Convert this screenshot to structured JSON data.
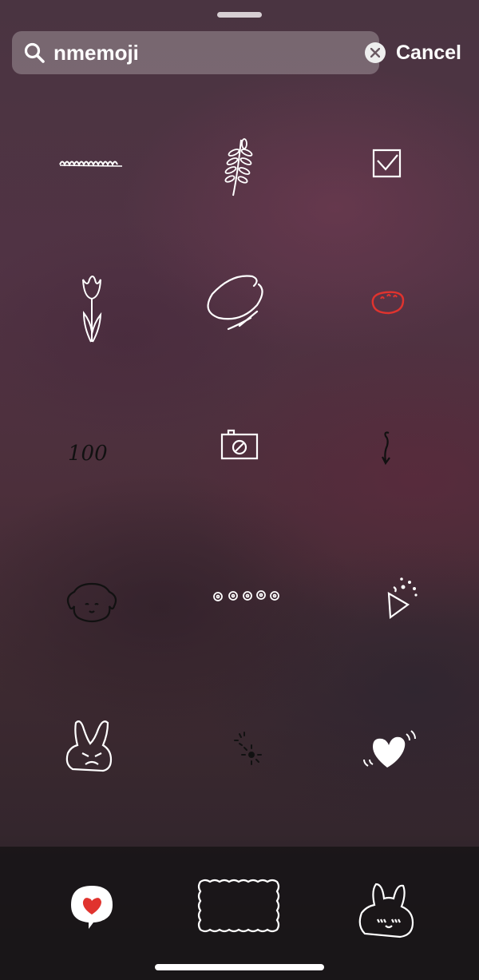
{
  "search": {
    "query": "nmemoji",
    "cancel_label": "Cancel"
  },
  "icons": {
    "search": "magnifier-icon",
    "clear": "clear-x-icon"
  },
  "stickers": [
    {
      "name": "squiggle-line-sticker"
    },
    {
      "name": "leaf-branch-sticker"
    },
    {
      "name": "checkbox-sticker"
    },
    {
      "name": "tulip-sticker"
    },
    {
      "name": "circle-scribble-sticker"
    },
    {
      "name": "bread-sticker"
    },
    {
      "name": "hundred-sticker",
      "text": "100"
    },
    {
      "name": "camera-sticker"
    },
    {
      "name": "arrow-sticker"
    },
    {
      "name": "puppy-face-sticker"
    },
    {
      "name": "flower-row-sticker"
    },
    {
      "name": "party-popper-sticker"
    },
    {
      "name": "angry-bunny-sticker"
    },
    {
      "name": "sparkle-sticker"
    },
    {
      "name": "heart-sticker"
    }
  ],
  "tray": [
    {
      "name": "heart-speech-bubble-sticker"
    },
    {
      "name": "wavy-frame-sticker"
    },
    {
      "name": "bunny-blush-sticker"
    }
  ],
  "colors": {
    "accent_red": "#e0332e",
    "search_bg": "rgba(255,255,255,0.25)"
  }
}
